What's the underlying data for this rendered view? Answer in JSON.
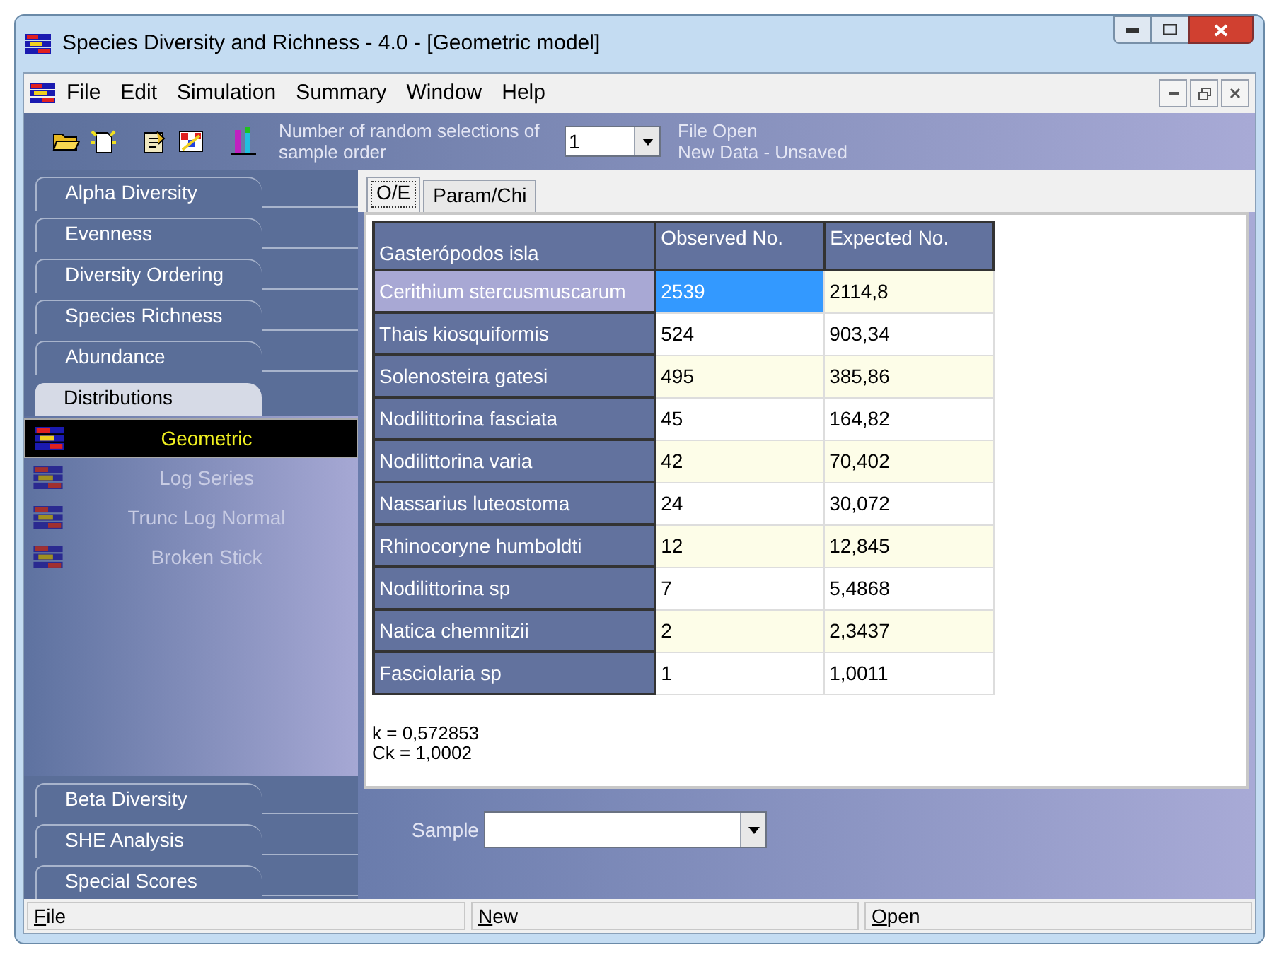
{
  "window": {
    "title": "Species Diversity and Richness - 4.0 - [Geometric model]"
  },
  "menu": [
    "File",
    "Edit",
    "Simulation",
    "Summary",
    "Window",
    "Help"
  ],
  "toolbar": {
    "selections_label": "Number of random selections of sample order",
    "selections_value": "1",
    "status_lines": [
      "File Open",
      "New Data - Unsaved"
    ]
  },
  "sidebar": {
    "top_tabs": [
      {
        "label": "Alpha Diversity",
        "selected": false
      },
      {
        "label": "Evenness",
        "selected": false
      },
      {
        "label": "Diversity Ordering",
        "selected": false
      },
      {
        "label": "Species Richness",
        "selected": false
      },
      {
        "label": "Abundance",
        "selected": false
      },
      {
        "label": "Distributions",
        "selected": true
      }
    ],
    "items": [
      {
        "label": "Geometric",
        "selected": true
      },
      {
        "label": "Log Series",
        "selected": false
      },
      {
        "label": "Trunc Log Normal",
        "selected": false
      },
      {
        "label": "Broken Stick",
        "selected": false
      }
    ],
    "bottom_tabs": [
      {
        "label": "Beta Diversity",
        "selected": false
      },
      {
        "label": "SHE Analysis",
        "selected": false
      },
      {
        "label": "Special Scores",
        "selected": false
      }
    ]
  },
  "tabs": [
    {
      "label": "O/E",
      "selected": true
    },
    {
      "label": "Param/Chi",
      "selected": false
    }
  ],
  "table": {
    "columns": [
      "Gasterópodos isla",
      "Observed No.",
      "Expected No."
    ],
    "rows": [
      {
        "name": "Cerithium stercusmuscarum",
        "observed": "2539",
        "expected": "2114,8",
        "selected": true
      },
      {
        "name": "Thais kiosquiformis",
        "observed": "524",
        "expected": "903,34",
        "selected": false
      },
      {
        "name": "Solenosteira gatesi",
        "observed": "495",
        "expected": "385,86",
        "selected": false
      },
      {
        "name": "Nodilittorina fasciata",
        "observed": "45",
        "expected": "164,82",
        "selected": false
      },
      {
        "name": "Nodilittorina varia",
        "observed": "42",
        "expected": "70,402",
        "selected": false
      },
      {
        "name": "Nassarius luteostoma",
        "observed": "24",
        "expected": "30,072",
        "selected": false
      },
      {
        "name": "Rhinocoryne humboldti",
        "observed": "12",
        "expected": "12,845",
        "selected": false
      },
      {
        "name": "Nodilittorina sp",
        "observed": "7",
        "expected": "5,4868",
        "selected": false
      },
      {
        "name": "Natica chemnitzii",
        "observed": "2",
        "expected": "2,3437",
        "selected": false
      },
      {
        "name": "Fasciolaria sp",
        "observed": "1",
        "expected": "1,0011",
        "selected": false
      }
    ]
  },
  "results": [
    "k = 0,572853",
    "Ck = 1,0002"
  ],
  "sample": {
    "label": "Sample"
  },
  "status_bar": [
    "File",
    "New",
    "Open"
  ]
}
